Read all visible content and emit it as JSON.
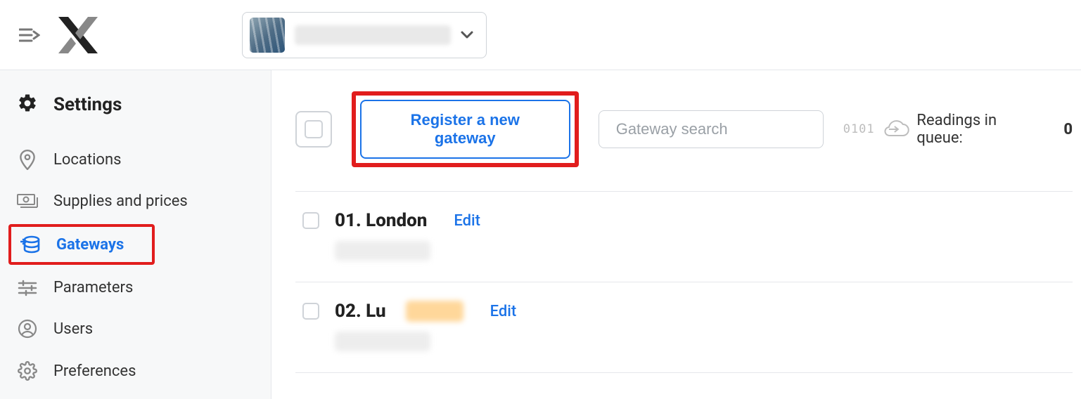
{
  "header": {
    "org_name_redacted": true
  },
  "sidebar": {
    "heading": "Settings",
    "items": [
      {
        "label": "Locations",
        "icon": "pin",
        "active": false
      },
      {
        "label": "Supplies and prices",
        "icon": "money",
        "active": false
      },
      {
        "label": "Gateways",
        "icon": "gateway",
        "active": true
      },
      {
        "label": "Parameters",
        "icon": "sliders",
        "active": false
      },
      {
        "label": "Users",
        "icon": "user",
        "active": false
      },
      {
        "label": "Preferences",
        "icon": "gear-light",
        "active": false
      }
    ]
  },
  "toolbar": {
    "register_label": "Register a new gateway",
    "search_placeholder": "Gateway search",
    "queue_binary": "0101",
    "queue_label": "Readings in queue:",
    "queue_value": "0"
  },
  "gateways": [
    {
      "title": "01. London",
      "edit_label": "Edit",
      "has_badge": false
    },
    {
      "title": "02. Lu",
      "edit_label": "Edit",
      "has_badge": true
    }
  ]
}
